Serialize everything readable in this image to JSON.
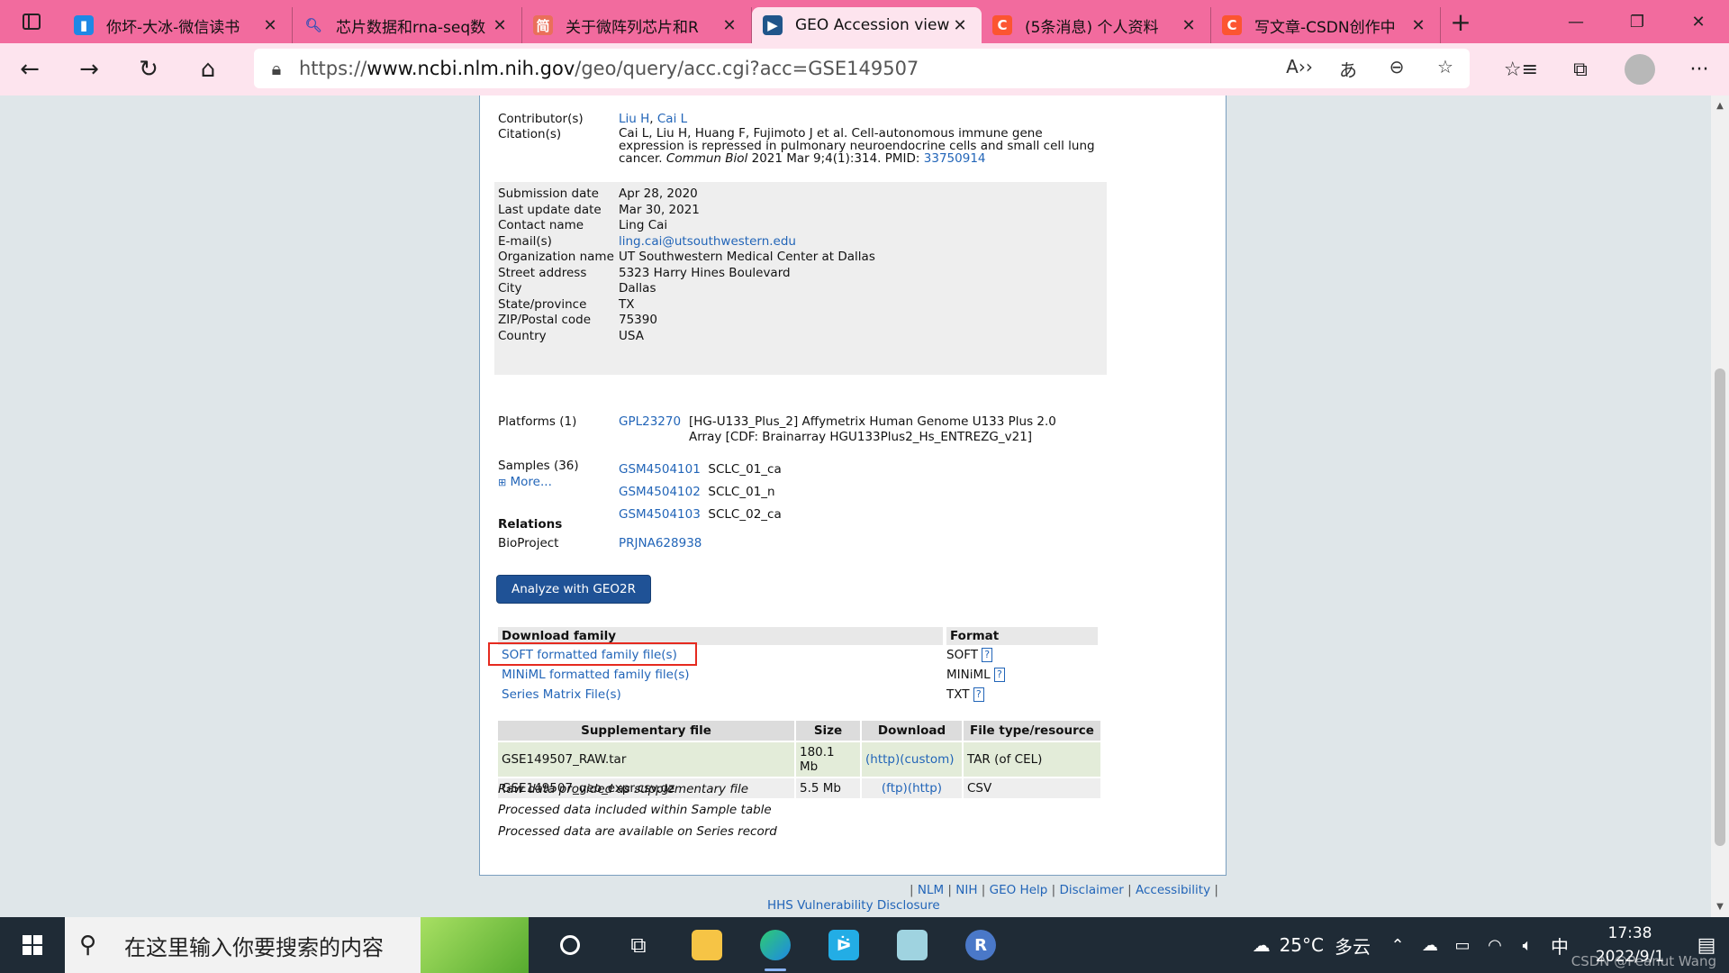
{
  "browser": {
    "tabs": [
      {
        "title": "你坏-大冰-微信读书",
        "icon": "book-icon",
        "color": "#1e88e5"
      },
      {
        "title": "芯片数据和rna-seq数",
        "icon": "search-icon",
        "color": "#3f51b5"
      },
      {
        "title": "关于微阵列芯片和R",
        "icon": "jianshu-icon",
        "color": "#ea6f5a"
      },
      {
        "title": "GEO Accession viewer",
        "icon": "ncbi-icon",
        "color": "#20558a",
        "active": true
      },
      {
        "title": "(5条消息) 个人资料",
        "icon": "csdn-icon",
        "color": "#fc5531"
      },
      {
        "title": "写文章-CSDN创作中",
        "icon": "csdn-icon",
        "color": "#fc5531"
      }
    ],
    "url_prefix": "https://",
    "url_domain": "www.ncbi.nlm.nih.gov",
    "url_path": "/geo/query/acc.cgi?acc=GSE149507"
  },
  "geo": {
    "contributors_label": "Contributor(s)",
    "contributors": [
      "Liu H",
      "Cai L"
    ],
    "citation_label": "Citation(s)",
    "citation_text": "Cai L, Liu H, Huang F, Fujimoto J et al. Cell-autonomous immune gene expression is repressed in pulmonary neuroendocrine cells and small cell lung cancer.",
    "citation_journal": "Commun Biol",
    "citation_tail": "2021 Mar 9;4(1):314. PMID:",
    "citation_pmid": "33750914",
    "info": [
      {
        "label": "Submission date",
        "value": "Apr 28, 2020"
      },
      {
        "label": "Last update date",
        "value": "Mar 30, 2021"
      },
      {
        "label": "Contact name",
        "value": "Ling Cai"
      },
      {
        "label": "E-mail(s)",
        "value": "ling.cai@utsouthwestern.edu",
        "link": true
      },
      {
        "label": "Organization name",
        "value": "UT Southwestern Medical Center at Dallas"
      },
      {
        "label": "Street address",
        "value": "5323 Harry Hines Boulevard"
      },
      {
        "label": "City",
        "value": "Dallas"
      },
      {
        "label": "State/province",
        "value": "TX"
      },
      {
        "label": "ZIP/Postal code",
        "value": "75390"
      },
      {
        "label": "Country",
        "value": "USA"
      }
    ],
    "platforms_label": "Platforms (1)",
    "platform_id": "GPL23270",
    "platform_desc_1": "[HG-U133_Plus_2] Affymetrix Human Genome U133 Plus 2.0",
    "platform_desc_2": "Array [CDF: Brainarray HGU133Plus2_Hs_ENTREZG_v21]",
    "samples_label": "Samples (36)",
    "more_label": "More...",
    "samples": [
      {
        "id": "GSM4504101",
        "name": "SCLC_01_ca"
      },
      {
        "id": "GSM4504102",
        "name": "SCLC_01_n"
      },
      {
        "id": "GSM4504103",
        "name": "SCLC_02_ca"
      }
    ],
    "relations_label": "Relations",
    "bioproject_label": "BioProject",
    "bioproject_id": "PRJNA628938",
    "geo2r_button": "Analyze with GEO2R",
    "download_family_header": "Download family",
    "format_header": "Format",
    "downloads": [
      {
        "label": "SOFT formatted family file(s)",
        "format": "SOFT"
      },
      {
        "label": "MINiML formatted family file(s)",
        "format": "MINiML"
      },
      {
        "label": "Series Matrix File(s)",
        "format": "TXT"
      }
    ],
    "supp_headers": [
      "Supplementary file",
      "Size",
      "Download",
      "File type/resource"
    ],
    "supp_rows": [
      {
        "file": "GSE149507_RAW.tar",
        "size": "180.1 Mb",
        "download": "(http)(custom)",
        "type": "TAR (of CEL)"
      },
      {
        "file": "GSE149507_geo_expr.csv.gz",
        "size": "5.5 Mb",
        "download": "(ftp)(http)",
        "type": "CSV"
      }
    ],
    "notes": [
      "Raw data provided as supplementary file",
      "Processed data included within Sample table",
      "Processed data are available on Series record"
    ],
    "footer_links": [
      "NLM",
      "NIH",
      "GEO Help",
      "Disclaimer",
      "Accessibility"
    ],
    "footer_link2": "HHS Vulnerability Disclosure"
  },
  "taskbar": {
    "search_placeholder": "在这里输入你要搜索的内容",
    "weather_temp": "25°C",
    "weather_desc": "多云",
    "ime": "中",
    "time": "17:38",
    "date": "2022/9/1",
    "watermark": "CSDN @Peanut Wang"
  }
}
